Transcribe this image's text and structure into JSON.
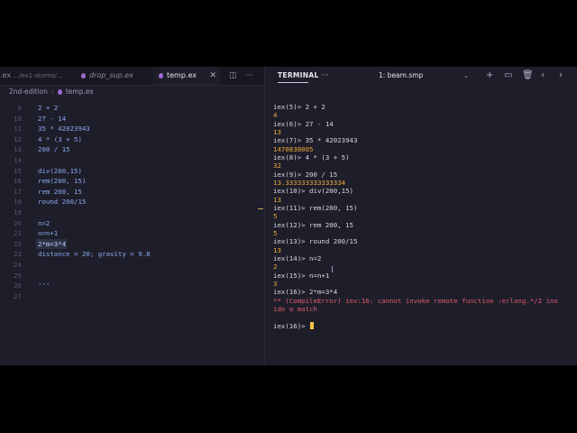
{
  "editor": {
    "tabs": [
      {
        "label": ".ex",
        "path": "  .../ex1-atoms/..."
      },
      {
        "label": "drop_sup.ex"
      },
      {
        "label": "temp.ex",
        "active": true
      }
    ],
    "breadcrumb": {
      "folder": "2nd-edition",
      "file": "temp.ex"
    },
    "lines": [
      {
        "n": "9",
        "t": "2 + 2"
      },
      {
        "n": "10",
        "t": "27 - 14"
      },
      {
        "n": "11",
        "t": "35 * 42023943"
      },
      {
        "n": "12",
        "t": "4 * (3 + 5)"
      },
      {
        "n": "13",
        "t": "200 / 15"
      },
      {
        "n": "14",
        "t": ""
      },
      {
        "n": "15",
        "t": "div(200,15)"
      },
      {
        "n": "16",
        "t": "rem(200, 15)"
      },
      {
        "n": "17",
        "t": "rem 200, 15"
      },
      {
        "n": "18",
        "t": "round 200/15"
      },
      {
        "n": "19",
        "t": ""
      },
      {
        "n": "20",
        "t": "n=2"
      },
      {
        "n": "21",
        "t": "n=n+1"
      },
      {
        "n": "22",
        "t": "2*m=3*4"
      },
      {
        "n": "23",
        "t": "distance = 20; gravity = 9.8"
      },
      {
        "n": "24",
        "t": ""
      },
      {
        "n": "25",
        "t": ""
      },
      {
        "n": "26",
        "t": "'''"
      },
      {
        "n": "27",
        "t": ""
      }
    ]
  },
  "terminal": {
    "title": "TERMINAL",
    "more_label": "···",
    "session": "1: beam.smp",
    "lines": [
      {
        "k": "prompt",
        "t": "iex(5)> 2 + 2"
      },
      {
        "k": "result",
        "t": "4"
      },
      {
        "k": "prompt",
        "t": "iex(6)> 27 - 14"
      },
      {
        "k": "result",
        "t": "13"
      },
      {
        "k": "prompt",
        "t": "iex(7)> 35 * 42023943"
      },
      {
        "k": "result",
        "t": "1470838005"
      },
      {
        "k": "prompt",
        "t": "iex(8)> 4 * (3 + 5)"
      },
      {
        "k": "result",
        "t": "32"
      },
      {
        "k": "prompt",
        "t": "iex(9)> 200 / 15"
      },
      {
        "k": "result",
        "t": "13.333333333333334"
      },
      {
        "k": "prompt",
        "t": "iex(10)> div(200,15)"
      },
      {
        "k": "result",
        "t": "13"
      },
      {
        "k": "prompt",
        "t": "iex(11)> rem(200, 15)"
      },
      {
        "k": "result",
        "t": "5"
      },
      {
        "k": "prompt",
        "t": "iex(12)> rem 200, 15"
      },
      {
        "k": "result",
        "t": "5"
      },
      {
        "k": "prompt",
        "t": "iex(13)> round 200/15"
      },
      {
        "k": "result",
        "t": "13"
      },
      {
        "k": "prompt",
        "t": "iex(14)> n=2"
      },
      {
        "k": "result",
        "t": "2"
      },
      {
        "k": "prompt",
        "t": "iex(15)> n=n+1"
      },
      {
        "k": "result",
        "t": "3"
      },
      {
        "k": "prompt",
        "t": "iex(16)> 2*m=3*4"
      },
      {
        "k": "error",
        "t": "** (CompileError) iex:16: cannot invoke remote function :erlang.*/2 ins"
      },
      {
        "k": "error",
        "t": "ide a match"
      },
      {
        "k": "blank",
        "t": ""
      },
      {
        "k": "prompt",
        "t": "iex(16)> "
      }
    ]
  },
  "colors": {
    "background": "#1e1e2a",
    "code_text": "#89a8ee",
    "prompt_text": "#d7d7e4",
    "result_text": "#f0a93a",
    "error_text": "#e05b6d",
    "cursor": "#f5c542"
  }
}
